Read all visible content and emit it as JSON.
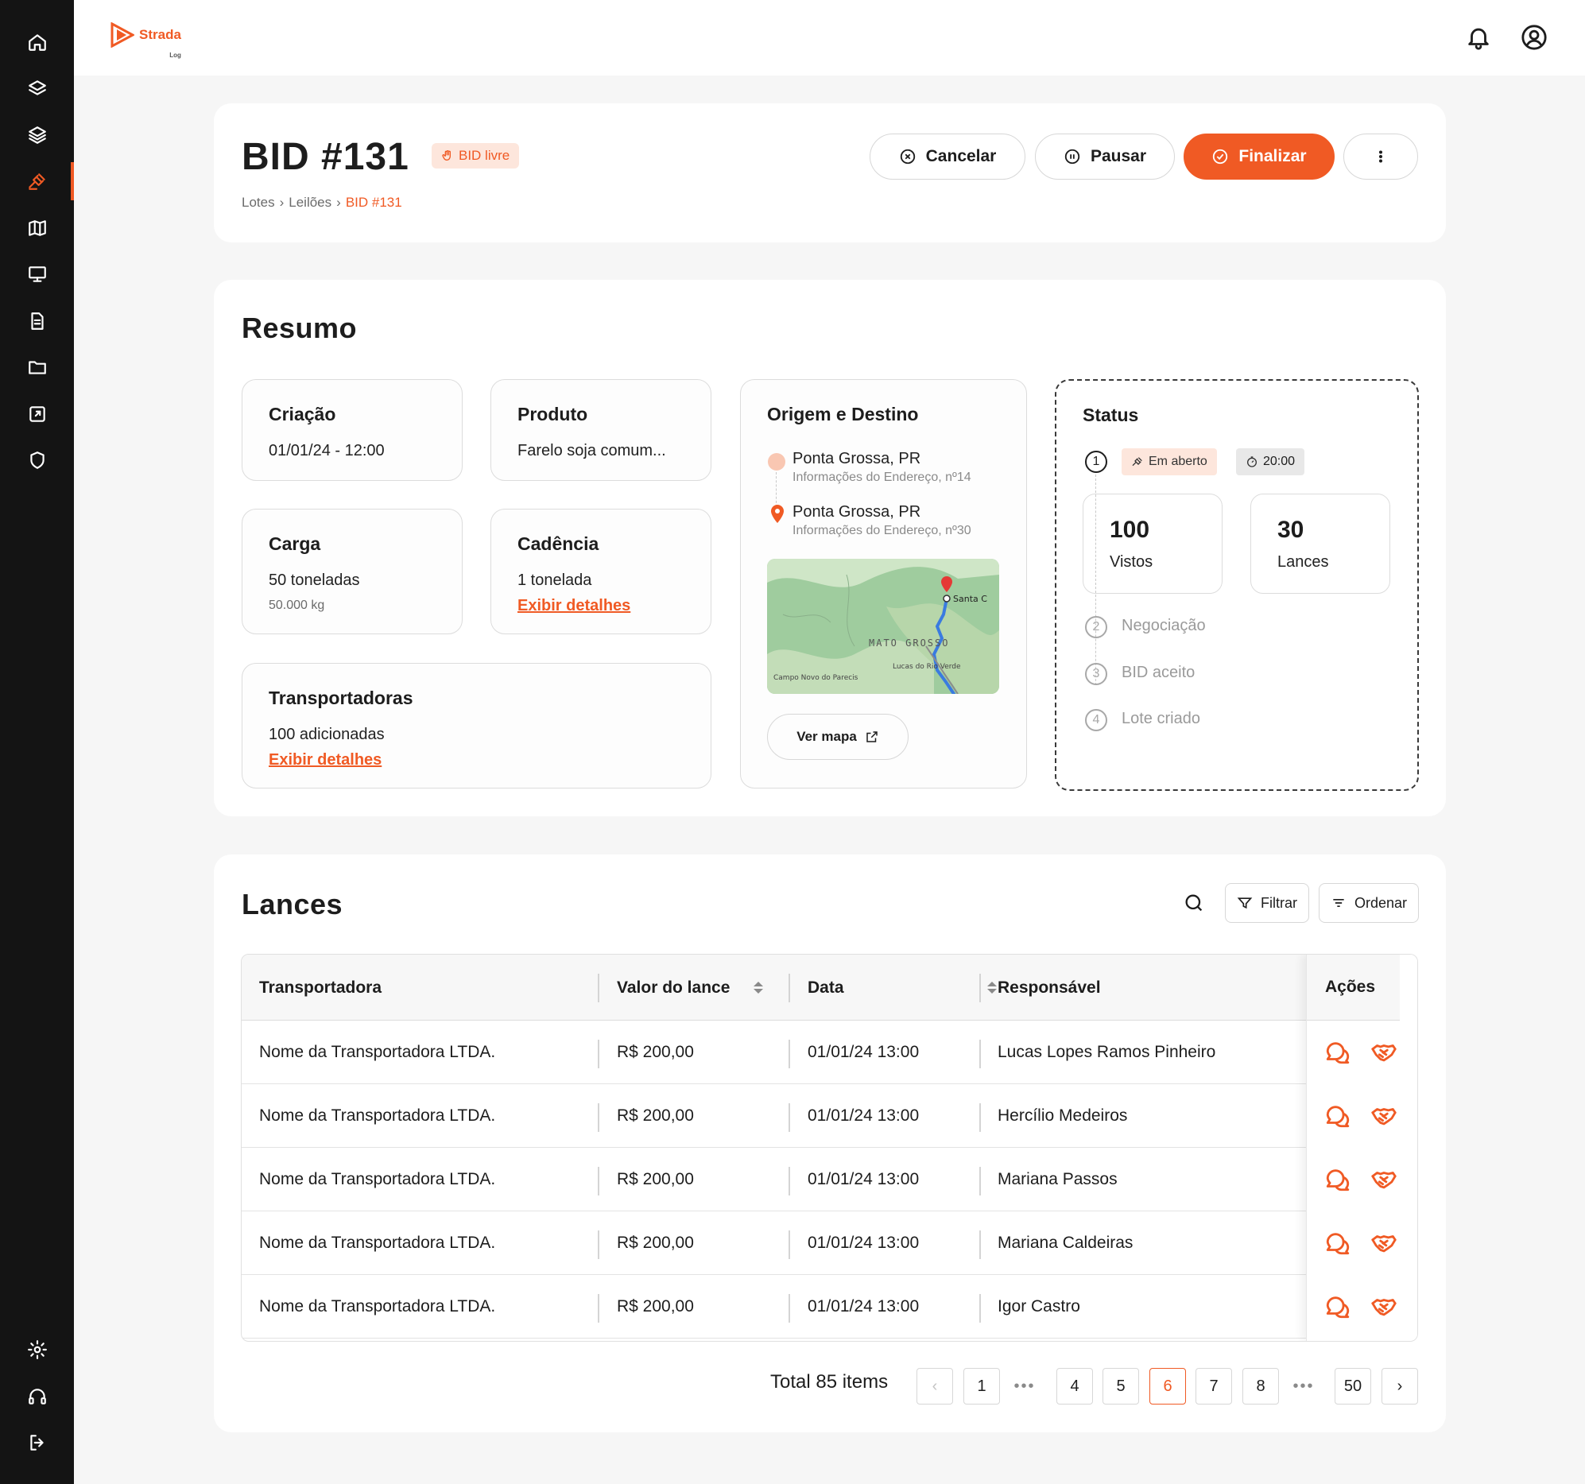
{
  "brand": {
    "name": "Strada",
    "sub": "Log",
    "accent": "#f05a24"
  },
  "sidebar": {
    "items": [
      {
        "icon": "home-icon"
      },
      {
        "icon": "layers-icon"
      },
      {
        "icon": "stack-icon"
      },
      {
        "icon": "gavel-icon",
        "active": true
      },
      {
        "icon": "map-icon"
      },
      {
        "icon": "monitor-icon"
      },
      {
        "icon": "document-icon"
      },
      {
        "icon": "folder-icon"
      },
      {
        "icon": "export-icon"
      },
      {
        "icon": "shield-icon"
      }
    ],
    "bottom": [
      {
        "icon": "gear-icon"
      },
      {
        "icon": "headset-icon"
      },
      {
        "icon": "logout-icon"
      }
    ]
  },
  "header": {
    "title": "BID #131",
    "tag": "BID livre",
    "breadcrumb": [
      "Lotes",
      "Leilões",
      "BID #131"
    ],
    "buttons": {
      "cancel": "Cancelar",
      "pause": "Pausar",
      "finish": "Finalizar"
    }
  },
  "summary": {
    "title": "Resumo",
    "creation": {
      "title": "Criação",
      "value": "01/01/24 - 12:00"
    },
    "product": {
      "title": "Produto",
      "value": "Farelo soja comum..."
    },
    "load": {
      "title": "Carga",
      "value": "50 toneladas",
      "sub": "50.000 kg"
    },
    "cadence": {
      "title": "Cadência",
      "value": "1 tonelada",
      "link": "Exibir detalhes"
    },
    "carriers": {
      "title": "Transportadoras",
      "value": "100 adicionadas",
      "link": "Exibir detalhes"
    },
    "route": {
      "title": "Origem e Destino",
      "origin": {
        "name": "Ponta Grossa, PR",
        "address": "Informações do Endereço, nº14"
      },
      "destination": {
        "name": "Ponta Grossa, PR",
        "address": "Informações do Endereço, nº30"
      },
      "map_labels": [
        "Santa C",
        "MATO GROSSO",
        "Campo Novo do Parecis",
        "Lucas do Rio Verde"
      ],
      "map_button": "Ver mapa"
    },
    "status": {
      "title": "Status",
      "steps": [
        {
          "n": "1",
          "label": "",
          "active": true
        },
        {
          "n": "2",
          "label": "Negociação"
        },
        {
          "n": "3",
          "label": "BID aceito"
        },
        {
          "n": "4",
          "label": "Lote criado"
        }
      ],
      "state_chip": "Em aberto",
      "timer": "20:00",
      "views": {
        "value": "100",
        "label": "Vistos"
      },
      "bids": {
        "value": "30",
        "label": "Lances"
      }
    }
  },
  "bids": {
    "title": "Lances",
    "filter": "Filtrar",
    "sort": "Ordenar",
    "columns": [
      "Transportadora",
      "Valor do lance",
      "Data",
      "Responsável",
      "Ações"
    ],
    "rows": [
      {
        "carrier": "Nome da Transportadora LTDA.",
        "value": "R$ 200,00",
        "date": "01/01/24  13:00",
        "responsible": "Lucas Lopes Ramos Pinheiro"
      },
      {
        "carrier": "Nome da Transportadora LTDA.",
        "value": "R$ 200,00",
        "date": "01/01/24  13:00",
        "responsible": "Hercílio Medeiros"
      },
      {
        "carrier": "Nome da Transportadora LTDA.",
        "value": "R$ 200,00",
        "date": "01/01/24  13:00",
        "responsible": "Mariana Passos"
      },
      {
        "carrier": "Nome da Transportadora LTDA.",
        "value": "R$ 200,00",
        "date": "01/01/24  13:00",
        "responsible": "Mariana Caldeiras"
      },
      {
        "carrier": "Nome da Transportadora LTDA.",
        "value": "R$ 200,00",
        "date": "01/01/24  13:00",
        "responsible": "Igor Castro"
      }
    ],
    "pagination": {
      "total": "Total 85 items",
      "pages": [
        "1",
        "4",
        "5",
        "6",
        "7",
        "8",
        "50"
      ],
      "current": "6",
      "dots": "•••"
    }
  }
}
